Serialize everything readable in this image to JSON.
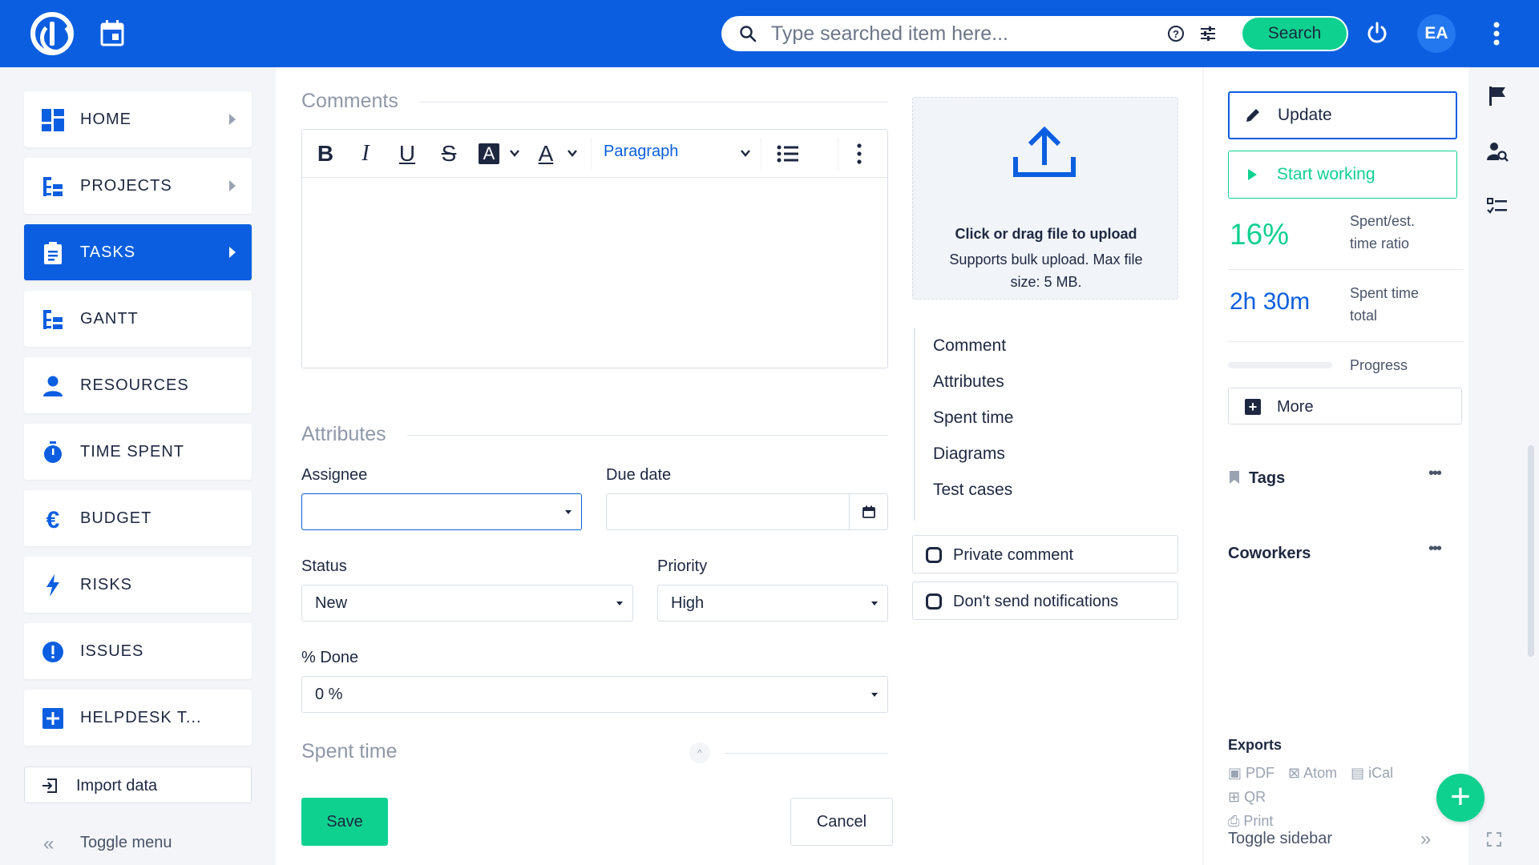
{
  "topbar": {
    "search_placeholder": "Type searched item here...",
    "search_button": "Search",
    "avatar_initials": "EA",
    "brand_color": "#0b5ee0",
    "accent_color": "#0fd18f"
  },
  "leftnav": {
    "items": [
      {
        "label": "HOME",
        "icon": "dashboard-icon",
        "active": false,
        "has_arrow": true
      },
      {
        "label": "PROJECTS",
        "icon": "hierarchy-icon",
        "active": false,
        "has_arrow": true
      },
      {
        "label": "TASKS",
        "icon": "clipboard-icon",
        "active": true,
        "has_arrow": true
      },
      {
        "label": "GANTT",
        "icon": "gantt-icon",
        "active": false,
        "has_arrow": false
      },
      {
        "label": "RESOURCES",
        "icon": "person-icon",
        "active": false,
        "has_arrow": false
      },
      {
        "label": "TIME SPENT",
        "icon": "stopwatch-icon",
        "active": false,
        "has_arrow": false
      },
      {
        "label": "BUDGET",
        "icon": "euro-icon",
        "active": false,
        "has_arrow": false
      },
      {
        "label": "RISKS",
        "icon": "lightning-icon",
        "active": false,
        "has_arrow": false
      },
      {
        "label": "ISSUES",
        "icon": "exclamation-icon",
        "active": false,
        "has_arrow": false
      },
      {
        "label": "HELPDESK T...",
        "icon": "plus-square-icon",
        "active": false,
        "has_arrow": false
      }
    ],
    "import_label": "Import data",
    "toggle_label": "Toggle menu"
  },
  "main": {
    "comments_title": "Comments",
    "editor": {
      "bold": "B",
      "italic": "I",
      "underline": "U",
      "strike": "S",
      "highlight": "A",
      "font_color": "A",
      "paragraph": "Paragraph"
    },
    "attributes_title": "Attributes",
    "assignee_label": "Assignee",
    "assignee_value": "",
    "due_date_label": "Due date",
    "due_date_value": "",
    "status_label": "Status",
    "status_value": "New",
    "priority_label": "Priority",
    "priority_value": "High",
    "done_label": "% Done",
    "done_value": "0 %",
    "spent_time_title": "Spent time",
    "save_label": "Save",
    "cancel_label": "Cancel",
    "upload": {
      "title": "Click or drag file to upload",
      "subtitle": "Supports bulk upload. Max file size: 5 MB."
    },
    "anchors": [
      "Comment",
      "Attributes",
      "Spent time",
      "Diagrams",
      "Test cases"
    ],
    "private_comment": "Private comment",
    "dont_send": "Don't send notifications"
  },
  "rightbar": {
    "update_label": "Update",
    "start_label": "Start working",
    "ratio_value": "16%",
    "ratio_label": "Spent/est. time ratio",
    "spent_value": "2h 30m",
    "spent_label": "Spent time total",
    "progress_label": "Progress",
    "progress_fraction": 0,
    "more_label": "More",
    "tags_title": "Tags",
    "coworkers_title": "Coworkers",
    "exports_title": "Exports",
    "exports": {
      "pdf": "PDF",
      "atom": "Atom",
      "ical": "iCal",
      "qr": "QR",
      "print": "Print"
    },
    "toggle_sidebar": "Toggle sidebar"
  },
  "strip": {
    "icons": [
      "flag-icon",
      "user-search-icon",
      "checklist-icon"
    ]
  }
}
